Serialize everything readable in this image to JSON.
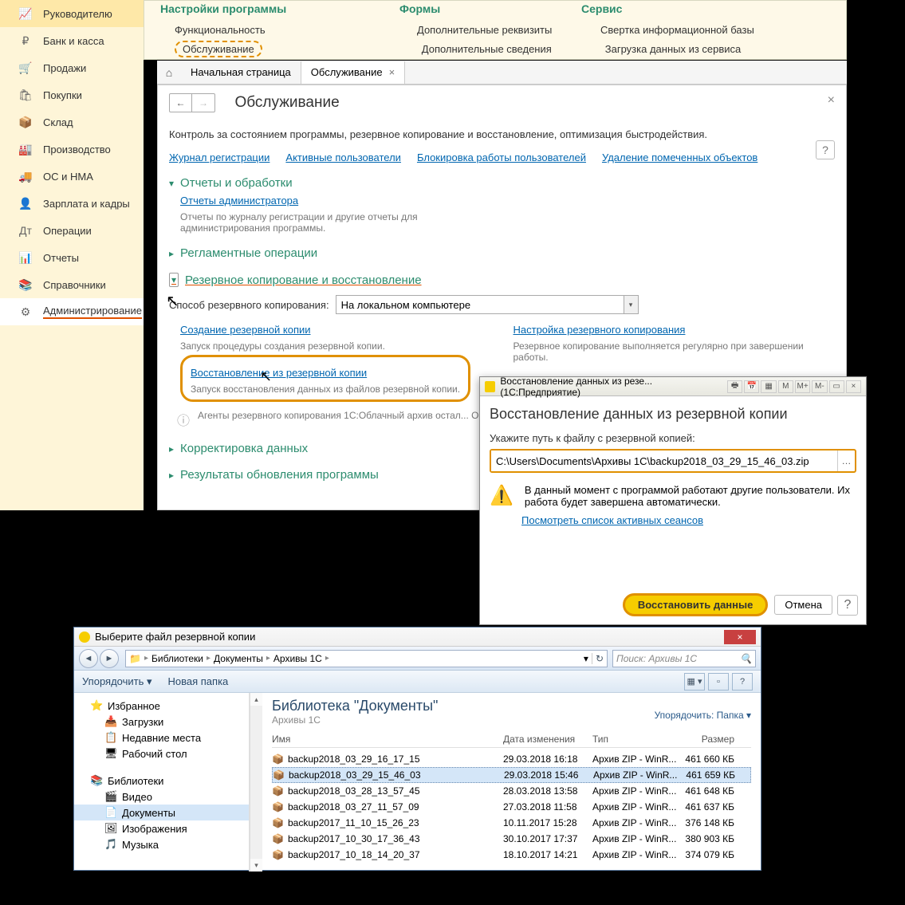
{
  "sidebar": {
    "items": [
      {
        "icon": "📈",
        "label": "Руководителю"
      },
      {
        "icon": "₽",
        "label": "Банк и касса"
      },
      {
        "icon": "🛒",
        "label": "Продажи"
      },
      {
        "icon": "🛍",
        "label": "Покупки"
      },
      {
        "icon": "📦",
        "label": "Склад"
      },
      {
        "icon": "🏭",
        "label": "Производство"
      },
      {
        "icon": "🚚",
        "label": "ОС и НМА"
      },
      {
        "icon": "👤",
        "label": "Зарплата и кадры"
      },
      {
        "icon": "Дт",
        "label": "Операции"
      },
      {
        "icon": "📊",
        "label": "Отчеты"
      },
      {
        "icon": "📚",
        "label": "Справочники"
      },
      {
        "icon": "⚙",
        "label": "Администрирование"
      }
    ]
  },
  "top": {
    "h1": "Настройки программы",
    "h2": "Формы",
    "h3": "Сервис",
    "r1c1": "Функциональность",
    "r1c2": "Дополнительные реквизиты",
    "r1c3": "Свертка информационной базы",
    "r2c1": "Обслуживание",
    "r2c2": "Дополнительные сведения",
    "r2c3": "Загрузка данных из сервиса"
  },
  "tabs": {
    "home": "Начальная страница",
    "active": "Обслуживание"
  },
  "page": {
    "title": "Обслуживание",
    "intro": "Контроль за состоянием программы, резервное копирование и восстановление, оптимизация быстродействия.",
    "links": [
      "Журнал регистрации",
      "Активные пользователи",
      "Блокировка работы пользователей",
      "Удаление помеченных объектов"
    ],
    "sec1": "Отчеты и обработки",
    "sec1_link": "Отчеты администратора",
    "sec1_desc": "Отчеты по журналу регистрации и другие отчеты для администрирования программы.",
    "sec2": "Регламентные операции",
    "sec3": "Резервное копирование и восстановление",
    "method_lbl": "Способ резервного копирования:",
    "method_val": "На локальном компьютере",
    "create_link": "Создание резервной копии",
    "create_desc": "Запуск процедуры создания резервной копии.",
    "setup_link": "Настройка резервного копирования",
    "setup_desc": "Резервное копирование выполняется регулярно при завершении работы.",
    "restore_link": "Восстановление из резервной копии",
    "restore_desc": "Запуск восстановления данных из файлов резервной копии.",
    "agents": "Агенты резервного копирования 1С:Облачный архив остал... Они могут продолжать делать резервные копии. Чтобы их от",
    "sec4": "Корректировка данных",
    "sec5": "Результаты обновления программы"
  },
  "dlg": {
    "title": "Восстановление данных из резе... (1С:Предприятие)",
    "header": "Восстановление данных из резервной копии",
    "path_lbl": "Укажите путь к файлу с резервной копией:",
    "path_val": "C:\\Users\\Documents\\Архивы 1С\\backup2018_03_29_15_46_03.zip",
    "warn": "В данный момент с программой работают другие пользователи. Их работа будет завершена автоматически.",
    "sessions": "Посмотреть список активных сеансов",
    "ok": "Восстановить данные",
    "cancel": "Отмена"
  },
  "exp": {
    "title": "Выберите файл резервной копии",
    "crumbs": [
      "Библиотеки",
      "Документы",
      "Архивы 1С"
    ],
    "search_ph": "Поиск: Архивы 1С",
    "organize": "Упорядочить",
    "newfolder": "Новая папка",
    "tree_fav": "Избранное",
    "tree_dl": "Загрузки",
    "tree_recent": "Недавние места",
    "tree_desktop": "Рабочий стол",
    "tree_lib": "Библиотеки",
    "tree_video": "Видео",
    "tree_docs": "Документы",
    "tree_img": "Изображения",
    "tree_music": "Музыка",
    "lib_h": "Библиотека \"Документы\"",
    "lib_sub": "Архивы 1С",
    "sort": "Упорядочить:",
    "sort_val": "Папка ▾",
    "col_name": "Имя",
    "col_date": "Дата изменения",
    "col_type": "Тип",
    "col_size": "Размер",
    "files": [
      {
        "name": "backup2018_03_29_16_17_15",
        "date": "29.03.2018 16:18",
        "type": "Архив ZIP - WinR...",
        "size": "461 660 КБ"
      },
      {
        "name": "backup2018_03_29_15_46_03",
        "date": "29.03.2018 15:46",
        "type": "Архив ZIP - WinR...",
        "size": "461 659 КБ"
      },
      {
        "name": "backup2018_03_28_13_57_45",
        "date": "28.03.2018 13:58",
        "type": "Архив ZIP - WinR...",
        "size": "461 648 КБ"
      },
      {
        "name": "backup2018_03_27_11_57_09",
        "date": "27.03.2018 11:58",
        "type": "Архив ZIP - WinR...",
        "size": "461 637 КБ"
      },
      {
        "name": "backup2017_11_10_15_26_23",
        "date": "10.11.2017 15:28",
        "type": "Архив ZIP - WinR...",
        "size": "376 148 КБ"
      },
      {
        "name": "backup2017_10_30_17_36_43",
        "date": "30.10.2017 17:37",
        "type": "Архив ZIP - WinR...",
        "size": "380 903 КБ"
      },
      {
        "name": "backup2017_10_18_14_20_37",
        "date": "18.10.2017 14:21",
        "type": "Архив ZIP - WinR...",
        "size": "374 079 КБ"
      }
    ]
  }
}
